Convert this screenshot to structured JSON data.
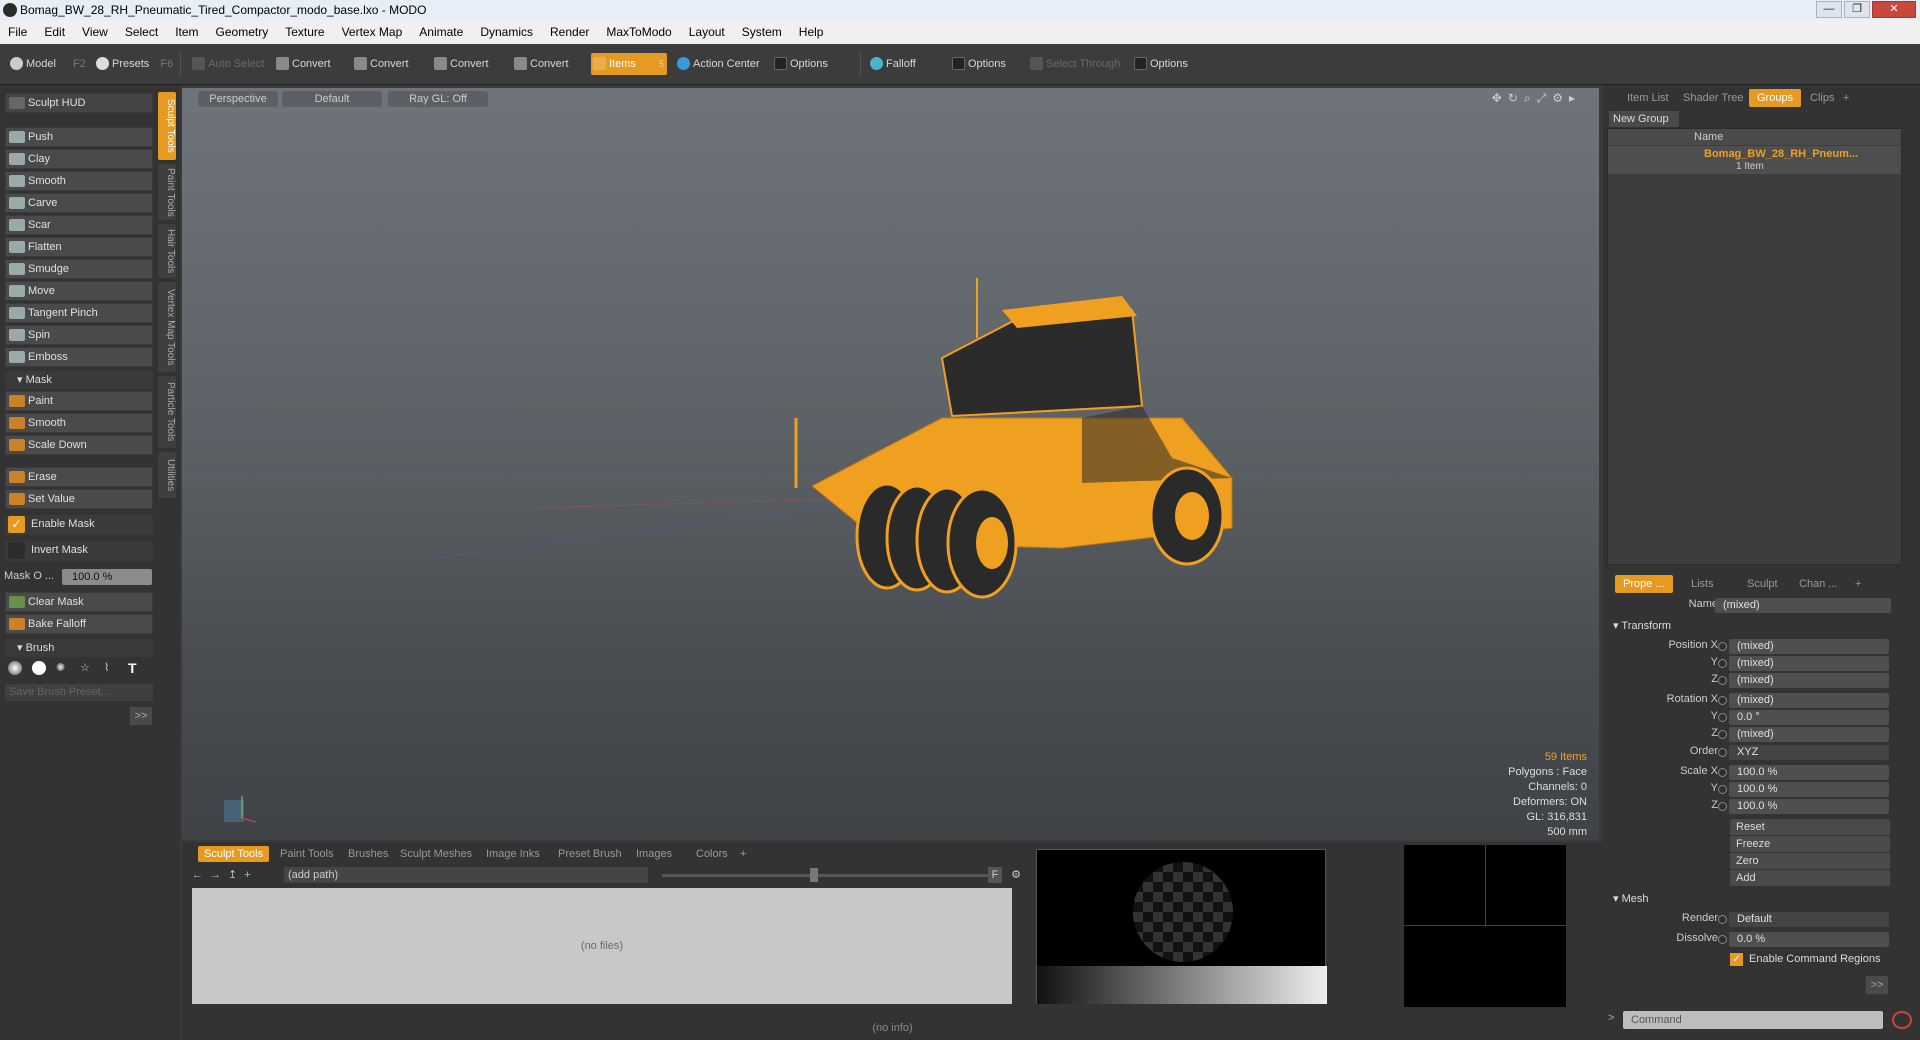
{
  "window": {
    "title": "Bomag_BW_28_RH_Pneumatic_Tired_Compactor_modo_base.lxo - MODO",
    "buttons": [
      "—",
      "❐",
      "✕"
    ]
  },
  "menu": [
    "File",
    "Edit",
    "View",
    "Select",
    "Item",
    "Geometry",
    "Texture",
    "Vertex Map",
    "Animate",
    "Dynamics",
    "Render",
    "MaxToModo",
    "Layout",
    "System",
    "Help"
  ],
  "toolbar": {
    "model": "Model",
    "model_key": "F2",
    "presets": "Presets",
    "presets_key": "F6",
    "auto_select": "Auto Select",
    "convert": "Convert",
    "items": "Items",
    "items_key": "5",
    "action_center": "Action Center",
    "options": "Options",
    "falloff": "Falloff",
    "select_through": "Select Through"
  },
  "sculpt": {
    "hud": "Sculpt HUD",
    "tools": [
      "Push",
      "Clay",
      "Smooth",
      "Carve",
      "Scar",
      "Flatten",
      "Smudge",
      "Move",
      "Tangent Pinch",
      "Spin",
      "Emboss"
    ],
    "mask_header": "Mask",
    "mask_tools": [
      "Paint",
      "Smooth",
      "Scale Down"
    ],
    "erase": "Erase",
    "set_value": "Set Value",
    "enable_mask": "Enable Mask",
    "invert_mask": "Invert Mask",
    "mask_opacity_label": "Mask O ...",
    "mask_opacity": "100.0 %",
    "clear_mask": "Clear Mask",
    "bake_falloff": "Bake Falloff",
    "brush_header": "Brush",
    "save_preset": "Save Brush Preset...",
    "more": ">>"
  },
  "side_tabs": [
    "Sculpt Tools",
    "Paint Tools",
    "Hair Tools",
    "Vertex Map Tools",
    "Particle Tools",
    "Utilities"
  ],
  "viewport": {
    "view": "Perspective",
    "style": "Default",
    "raygl": "Ray GL: Off",
    "stats": {
      "items": "59 Items",
      "polygons": "Polygons : Face",
      "channels": "Channels: 0",
      "deformers": "Deformers: ON",
      "gl": "GL: 316,831",
      "size": "500 mm"
    }
  },
  "right_tabs": [
    "Item List",
    "Shader Tree",
    "Groups",
    "Clips",
    "+"
  ],
  "groups": {
    "new_group": "New Group",
    "col_name": "Name",
    "item_name": "Bomag_BW_28_RH_Pneum...",
    "item_count": "1 Item"
  },
  "props_tabs": [
    "Prope ...",
    "Lists",
    "Sculpt",
    "Chan ...",
    "+"
  ],
  "props": {
    "name_label": "Name",
    "name_value": "(mixed)",
    "transform": "Transform",
    "pos_label": "Position X",
    "rot_label": "Rotation X",
    "y": "Y",
    "z": "Z",
    "mixed": "(mixed)",
    "zero_deg": "0.0 °",
    "order_label": "Order",
    "order": "XYZ",
    "scale_label": "Scale X",
    "pct": "100.0 %",
    "reset": "Reset",
    "freeze": "Freeze",
    "zero": "Zero",
    "add": "Add",
    "mesh": "Mesh",
    "render_label": "Render",
    "render": "Default",
    "dissolve_label": "Dissolve",
    "dissolve": "0.0 %",
    "enable_cmd": "Enable Command Regions",
    "more": ">>"
  },
  "bottom_tabs": [
    "Sculpt Tools",
    "Paint Tools",
    "Brushes",
    "Sculpt Meshes",
    "Image Inks",
    "Preset Brush",
    "Images",
    "Colors",
    "+"
  ],
  "browser": {
    "path": "(add path)",
    "empty": "(no files)",
    "f": "F"
  },
  "status": "(no info)",
  "command": {
    "prompt": ">",
    "placeholder": "Command"
  }
}
